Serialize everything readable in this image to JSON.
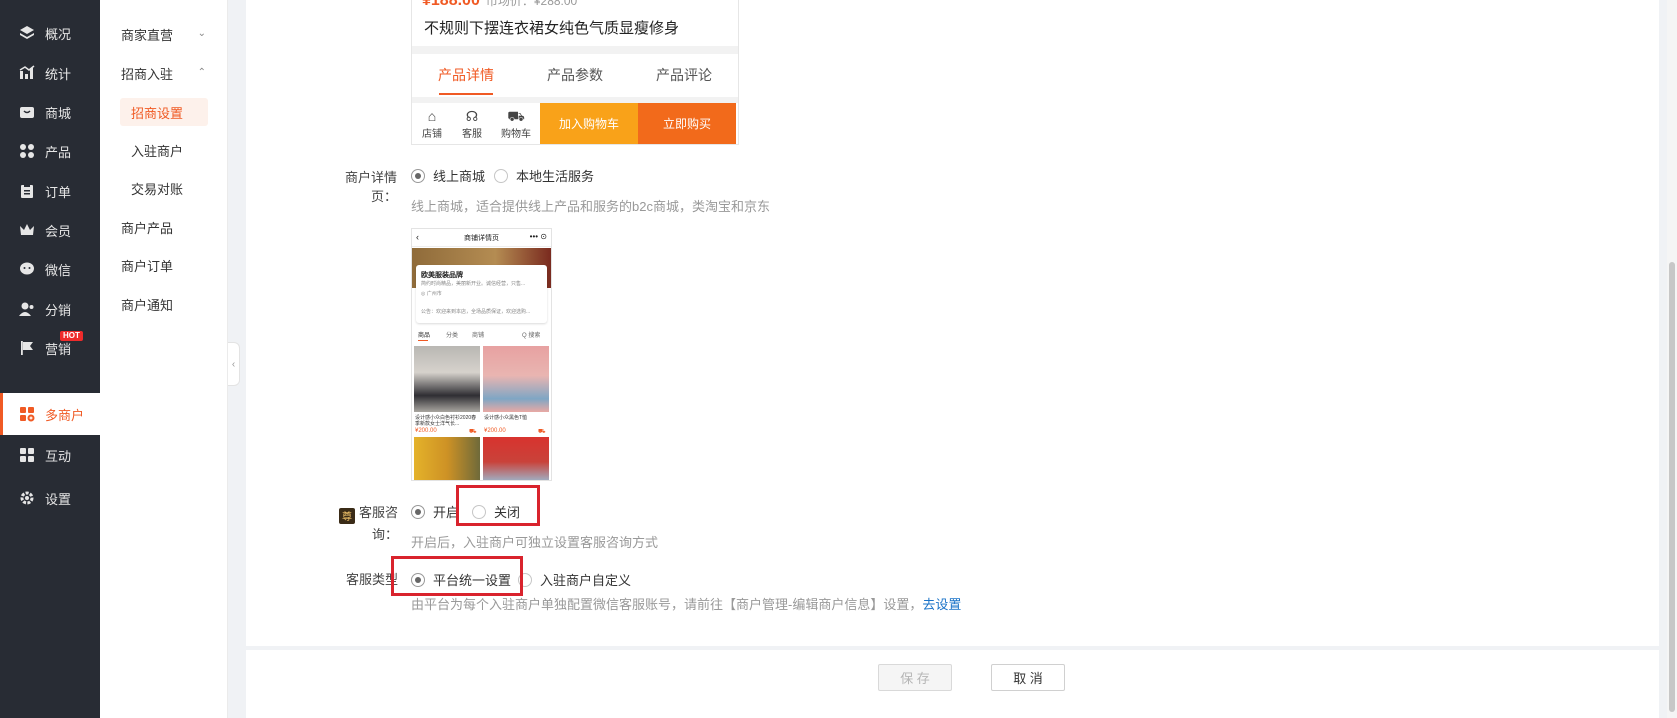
{
  "nav": {
    "items": [
      {
        "label": "概况",
        "icon": "layers-icon"
      },
      {
        "label": "统计",
        "icon": "chart-icon"
      },
      {
        "label": "商城",
        "icon": "mall-icon"
      },
      {
        "label": "产品",
        "icon": "product-icon"
      },
      {
        "label": "订单",
        "icon": "order-icon"
      },
      {
        "label": "会员",
        "icon": "crown-icon"
      },
      {
        "label": "微信",
        "icon": "wechat-icon"
      },
      {
        "label": "分销",
        "icon": "distribution-icon"
      },
      {
        "label": "营销",
        "icon": "flag-icon",
        "badge": "HOT"
      },
      {
        "label": "多商户",
        "icon": "multi-merchant-icon"
      },
      {
        "label": "互动",
        "icon": "interact-icon"
      },
      {
        "label": "设置",
        "icon": "gear-icon"
      }
    ],
    "active_index": 9
  },
  "submenu": {
    "items": [
      {
        "label": "商家直营",
        "caret": "⌄"
      },
      {
        "label": "招商入驻",
        "caret": "⌃"
      },
      {
        "label": "招商设置"
      },
      {
        "label": "入驻商户"
      },
      {
        "label": "交易对账"
      },
      {
        "label": "商户产品"
      },
      {
        "label": "商户订单"
      },
      {
        "label": "商户通知"
      }
    ]
  },
  "product_preview": {
    "price_partial": "¥188.00",
    "price_sub": "市场价：¥288.00",
    "title": "不规则下摆连衣裙女纯色气质显瘦修身",
    "tabs": [
      "产品详情",
      "产品参数",
      "产品评论"
    ],
    "icons": [
      {
        "label": "店铺",
        "glyph": "⌂"
      },
      {
        "label": "客服",
        "glyph": "☊"
      },
      {
        "label": "购物车",
        "glyph": "⛟"
      }
    ],
    "add_cart": "加入购物车",
    "buy_now": "立即购买",
    "colors": {
      "cart": "#f9a219",
      "buy": "#f26a1b",
      "accent": "#f05a24"
    }
  },
  "detail_page": {
    "label": "商户详情页：",
    "options": [
      "线上商城",
      "本地生活服务"
    ],
    "selected": 0,
    "hint": "线上商城，适合提供线上产品和服务的b2c商城，类淘宝和京东"
  },
  "store_preview": {
    "header": "商铺详情页",
    "store_name": "欧美服装品牌",
    "store_desc": "简约时尚精品，美丽新开业。诚信经营，只售...",
    "location": "◎ 广州市",
    "announcement": "公告：欢迎来到本店，全场品质保证，欢迎选购...",
    "tabs": [
      "商品",
      "分类",
      "商铺",
      "Q 搜索"
    ],
    "products": [
      {
        "name": "设计感小众白色衬衫2020春季新款女士洋气长...",
        "price": "¥200.00"
      },
      {
        "name": "设计感小众黑色T恤",
        "price": "¥200.00"
      }
    ]
  },
  "customer_service": {
    "badge": "尊",
    "label": "客服咨询：",
    "options": [
      "开启",
      "关闭"
    ],
    "selected": 0,
    "hint": "开启后，入驻商户可独立设置客服咨询方式"
  },
  "service_type": {
    "label": "客服类型",
    "options": [
      "平台统一设置",
      "入驻商户自定义"
    ],
    "selected": 0,
    "hint": "由平台为每个入驻商户单独配置微信客服账号，请前往【商户管理-编辑商户信息】设置，",
    "hint_link": "去设置"
  },
  "footer": {
    "save": "保 存",
    "cancel": "取 消"
  }
}
